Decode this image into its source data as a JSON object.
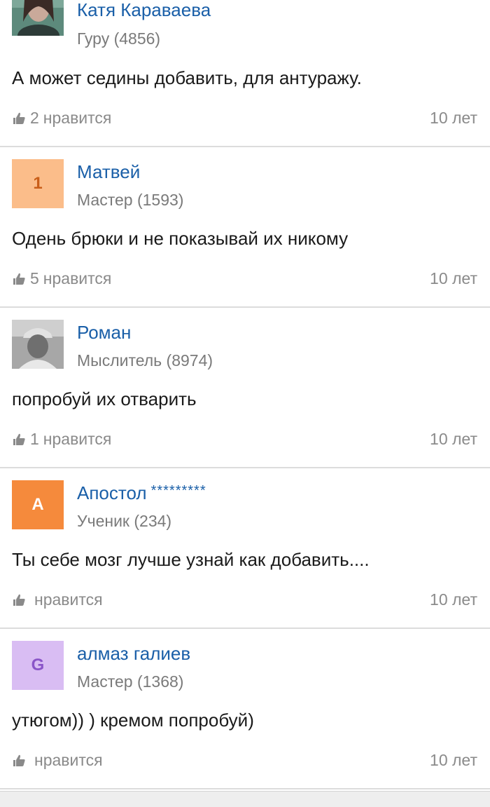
{
  "answers": [
    {
      "author": "Катя Караваева",
      "stars": "",
      "rank": "Гуру (4856)",
      "avatar": {
        "type": "photo",
        "letter": "",
        "bg": "#4a7066",
        "fg": "#ffffff",
        "icon": "user-photo"
      },
      "text": "А может седины добавить, для антуражу.",
      "likes_count": "2",
      "likes_label": "нравится",
      "age": "10 лет"
    },
    {
      "author": "Матвей",
      "stars": "",
      "rank": "Мастер (1593)",
      "avatar": {
        "type": "letter",
        "letter": "1",
        "bg": "#fbbd8a",
        "fg": "#c95e19",
        "icon": ""
      },
      "text": "Одень брюки и не показывай их никому",
      "likes_count": "5",
      "likes_label": "нравится",
      "age": "10 лет"
    },
    {
      "author": "Роман",
      "stars": "",
      "rank": "Мыслитель (8974)",
      "avatar": {
        "type": "photo",
        "letter": "",
        "bg": "#7d7d7d",
        "fg": "#ffffff",
        "icon": "user-photo"
      },
      "text": "попробуй их отварить",
      "likes_count": "1",
      "likes_label": "нравится",
      "age": "10 лет"
    },
    {
      "author": "Апостол",
      "stars": "*********",
      "rank": "Ученик (234)",
      "avatar": {
        "type": "letter",
        "letter": "А",
        "bg": "#f58a3c",
        "fg": "#ffffff",
        "icon": ""
      },
      "text": "Ты себе мозг лучше узнай как добавить....",
      "likes_count": "",
      "likes_label": "нравится",
      "age": "10 лет"
    },
    {
      "author": "алмаз галиев",
      "stars": "",
      "rank": "Мастер (1368)",
      "avatar": {
        "type": "letter",
        "letter": "G",
        "bg": "#d9bdf3",
        "fg": "#8a55c8",
        "icon": ""
      },
      "text": "утюгом)) ) кремом попробуй)",
      "likes_count": "",
      "likes_label": "нравится",
      "age": "10 лет"
    }
  ],
  "colors": {
    "link": "#1a5fa8",
    "muted": "#8a8a8a",
    "divider": "#dcdcdc"
  },
  "icons": {
    "like": "thumbs-up-icon"
  }
}
